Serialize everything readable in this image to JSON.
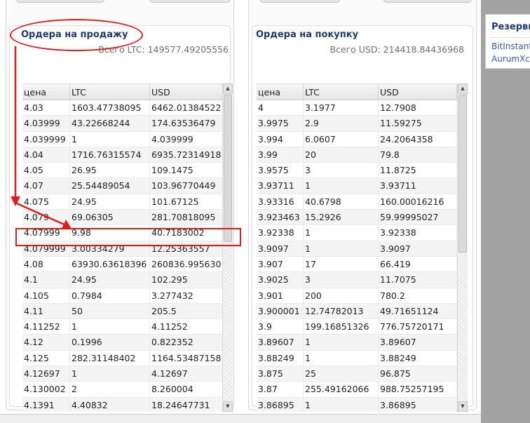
{
  "top_buttons": [
    "",
    "",
    "",
    ""
  ],
  "sell": {
    "title": "Ордера на продажу",
    "total": "Всего LTC: 149577.49205556",
    "columns": [
      "цена",
      "LTC",
      "USD"
    ],
    "rows": [
      [
        "4.03",
        "1603.47738095",
        "6462.01384522"
      ],
      [
        "4.03999",
        "43.22668244",
        "174.63536479"
      ],
      [
        "4.039999",
        "1",
        "4.039999"
      ],
      [
        "4.04",
        "1716.76315574",
        "6935.72314918"
      ],
      [
        "4.05",
        "26.95",
        "109.1475"
      ],
      [
        "4.07",
        "25.54489054",
        "103.96770449"
      ],
      [
        "4.075",
        "24.95",
        "101.67125"
      ],
      [
        "4.079",
        "69.06305",
        "281.70818095"
      ],
      [
        "4.07999",
        "9.98",
        "40.7183002"
      ],
      [
        "4.079999",
        "3.00334279",
        "12.25363557"
      ],
      [
        "4.08",
        "63930.63618396",
        "260836.995630"
      ],
      [
        "4.1",
        "24.95",
        "102.295"
      ],
      [
        "4.105",
        "0.7984",
        "3.277432"
      ],
      [
        "4.11",
        "50",
        "205.5"
      ],
      [
        "4.11252",
        "1",
        "4.11252"
      ],
      [
        "4.12",
        "0.1996",
        "0.822352"
      ],
      [
        "4.125",
        "282.31148402",
        "1164.53487158"
      ],
      [
        "4.12697",
        "1",
        "4.12697"
      ],
      [
        "4.130002",
        "2",
        "8.260004"
      ],
      [
        "4.1391",
        "4.40832",
        "18.24647731"
      ]
    ]
  },
  "buy": {
    "title": "Ордера на покупку",
    "total": "Всего USD: 214418.84436968",
    "columns": [
      "цена",
      "LTC",
      "USD"
    ],
    "rows": [
      [
        "4",
        "3.1977",
        "12.7908"
      ],
      [
        "3.9975",
        "2.9",
        "11.59275"
      ],
      [
        "3.994",
        "6.0607",
        "24.2064358"
      ],
      [
        "3.99",
        "20",
        "79.8"
      ],
      [
        "3.9575",
        "3",
        "11.8725"
      ],
      [
        "3.93711",
        "1",
        "3.93711"
      ],
      [
        "3.93316",
        "40.6798",
        "160.00016216"
      ],
      [
        "3.923463",
        "15.2926",
        "59.99995027"
      ],
      [
        "3.92338",
        "1",
        "3.92338"
      ],
      [
        "3.9097",
        "1",
        "3.9097"
      ],
      [
        "3.907",
        "17",
        "66.419"
      ],
      [
        "3.9025",
        "3",
        "11.7075"
      ],
      [
        "3.901",
        "200",
        "780.2"
      ],
      [
        "3.900001",
        "12.74782013",
        "49.71651124"
      ],
      [
        "3.9",
        "199.16851326",
        "776.75720171"
      ],
      [
        "3.89607",
        "1",
        "3.89607"
      ],
      [
        "3.88249",
        "1",
        "3.88249"
      ],
      [
        "3.875",
        "25",
        "96.875"
      ],
      [
        "3.87",
        "255.49162066",
        "988.75257195"
      ],
      [
        "3.86895",
        "1",
        "3.86895"
      ]
    ]
  },
  "reserves": {
    "title": "Резервы",
    "links": [
      "BitInstant",
      "AurumXchange"
    ]
  },
  "annotation_color": "#e11b1b",
  "icons": {
    "scroll_up": "triangle-up-icon",
    "scroll_down": "triangle-down-icon",
    "arrow": "red-arrow-icon"
  }
}
